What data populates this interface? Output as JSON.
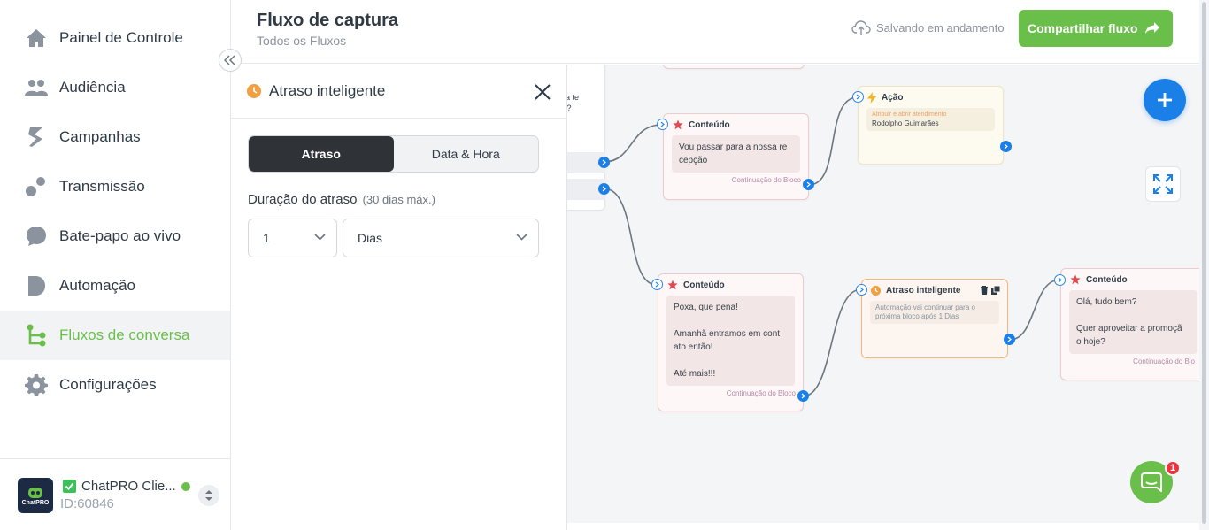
{
  "sidebar": {
    "items": [
      {
        "label": "Painel de Controle",
        "icon": "home-icon"
      },
      {
        "label": "Audiência",
        "icon": "users-icon"
      },
      {
        "label": "Campanhas",
        "icon": "campaign-icon"
      },
      {
        "label": "Transmissão",
        "icon": "broadcast-icon"
      },
      {
        "label": "Bate-papo ao vivo",
        "icon": "chat-bubble-icon"
      },
      {
        "label": "Automação",
        "icon": "automation-icon"
      },
      {
        "label": "Fluxos de conversa",
        "icon": "flow-icon",
        "active": true
      },
      {
        "label": "Configurações",
        "icon": "gear-icon"
      }
    ],
    "account": {
      "name": "ChatPRO Clie...",
      "id": "ID:60846",
      "avatar_text": "ChatPRO"
    }
  },
  "header": {
    "title": "Fluxo de captura",
    "subtitle": "Todos os Fluxos",
    "saving_text": "Salvando em andamento",
    "share_label": "Compartilhar fluxo"
  },
  "panel": {
    "title": "Atraso inteligente",
    "tabs": [
      "Atraso",
      "Data & Hora"
    ],
    "active_tab": "Atraso",
    "duration_label": "Duração do atraso",
    "duration_hint": "(30 dias máx.)",
    "amount_value": "1",
    "unit_value": "Dias"
  },
  "canvas": {
    "partial_text": "para te\nção?",
    "nodes": {
      "content1": {
        "title": "Conteúdo",
        "body": "Vou passar para a nossa re\ncepção",
        "footer": "Continuação do Bloco"
      },
      "action1": {
        "title": "Ação",
        "sub": "Atribuir e abrir atendimento",
        "body": "Rodolpho Guimarães"
      },
      "content2": {
        "title": "Conteúdo",
        "body": "Poxa, que pena!\n\nAmanhã entramos em cont\nato então!\n\nAté mais!!!",
        "footer": "Continuação do Bloco"
      },
      "delay1": {
        "title": "Atraso inteligente",
        "body": "Automação vai continuar para o\npróxima bloco após 1 Dias"
      },
      "content3": {
        "title": "Conteúdo",
        "body": "Olá, tudo bem?\n\nQuer aproveitar a promoçã\no hoje?",
        "footer": "Continuação do Blo"
      }
    },
    "chat_badge": "1"
  },
  "colors": {
    "accent_green": "#6abf4b",
    "accent_blue": "#1b7fe8",
    "dark": "#2f3338",
    "badge_red": "#e8353e"
  }
}
